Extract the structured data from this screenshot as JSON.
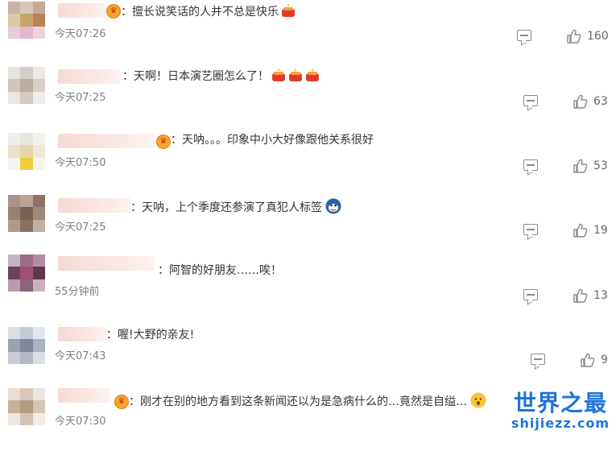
{
  "comments": [
    {
      "text": "：擅长说笑话的人并不总是快乐",
      "time": "今天07:26",
      "likes": "160",
      "emojis": [
        "cake-emoji"
      ]
    },
    {
      "text": "：天啊！日本演艺圈怎么了！",
      "time": "今天07:25",
      "likes": "63",
      "emojis": [
        "cake-emoji",
        "cake-emoji",
        "cake-emoji"
      ]
    },
    {
      "text": "：天呐。。。印象中小大好像跟他关系很好",
      "time": "今天07:50",
      "likes": "53",
      "emojis": []
    },
    {
      "text": "：天呐，上个季度还参演了真犯人标签",
      "time": "今天07:25",
      "likes": "19",
      "emojis": [
        "sweat-face-emoji"
      ]
    },
    {
      "text": "：阿智的好朋友……唉！",
      "time": "55分钟前",
      "likes": "13",
      "emojis": []
    },
    {
      "text": "：喔!大野的亲友!",
      "time": "今天07:43",
      "likes": "9",
      "emojis": []
    },
    {
      "text": "：刚才在别的地方看到这条新闻还以为是急病什么的…竟然是自缢…",
      "time": "今天07:30",
      "likes": "",
      "emojis": [
        "shocked-face-emoji"
      ]
    }
  ],
  "watermark": {
    "title": "世界之最",
    "url": "shijiezz.com"
  },
  "colors": {
    "text": "#333333",
    "meta": "#808080",
    "icon": "#8a8a8a",
    "watermark": "#1f74d6"
  }
}
